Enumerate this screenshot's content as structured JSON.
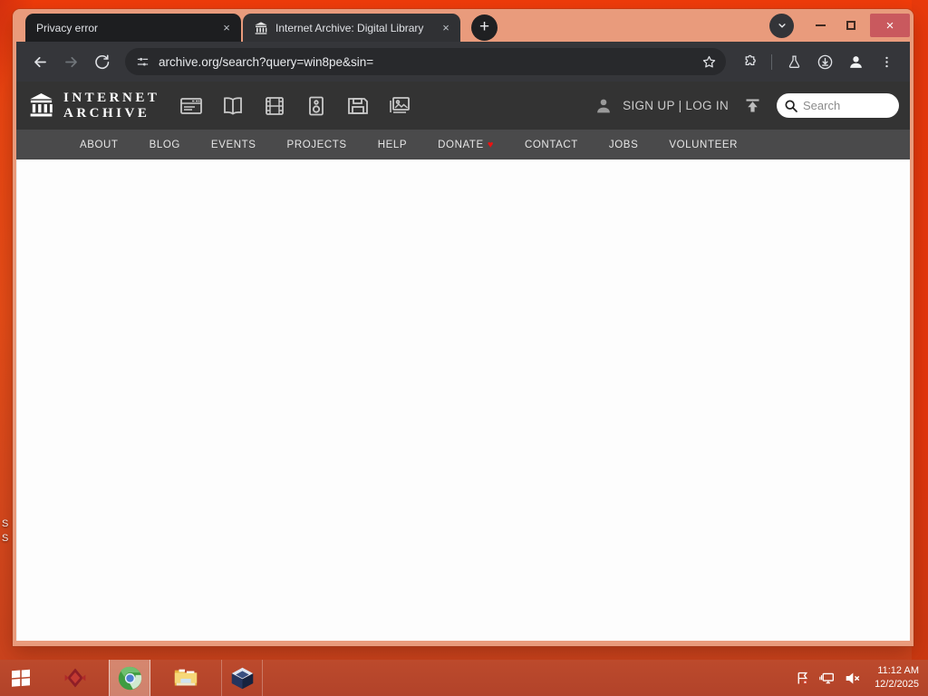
{
  "colors": {
    "desktop_orange": "#e8430f",
    "window_frame_salmon": "#e99b7c",
    "close_button_red": "#c9595e",
    "chrome_dark": "#35363a",
    "ia_header_dark": "#333333",
    "ia_nav_gray": "#4a4a4b",
    "donate_heart_red": "#ee1111",
    "taskbar_red": "#b5452b"
  },
  "glyphs": {
    "close": "×",
    "plus": "+",
    "heart": "♥"
  },
  "browser": {
    "tabs": [
      {
        "title": "Privacy error"
      },
      {
        "title": "Internet Archive: Digital Library"
      }
    ],
    "url": "archive.org/search?query=win8pe&sin="
  },
  "ia": {
    "wordmark_line1": "INTERNET",
    "wordmark_line2": "ARCHIVE",
    "media_icons": [
      "web",
      "texts",
      "video",
      "audio",
      "software",
      "images"
    ],
    "auth_text": "SIGN UP | LOG IN",
    "search_placeholder": "Search",
    "nav": [
      "ABOUT",
      "BLOG",
      "EVENTS",
      "PROJECTS",
      "HELP",
      "DONATE",
      "CONTACT",
      "JOBS",
      "VOLUNTEER"
    ]
  },
  "desktop": {
    "icon_label_fragment_1": "S",
    "icon_label_fragment_2": "S"
  },
  "taskbar": {
    "time": "11:12 AM",
    "date": "12/2/2025"
  }
}
